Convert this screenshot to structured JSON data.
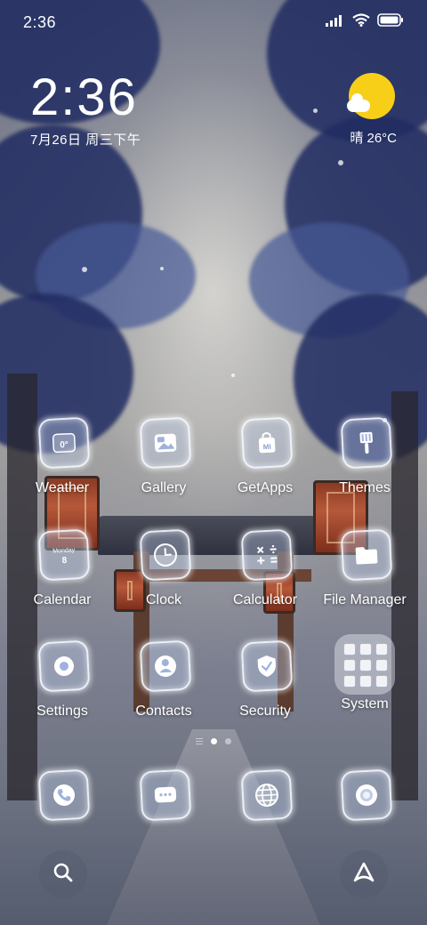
{
  "status_bar": {
    "time": "2:36",
    "icons": [
      "signal-icon",
      "wifi-icon",
      "battery-icon"
    ]
  },
  "clock_widget": {
    "time": "2:36",
    "date": "7月26日 周三下午"
  },
  "weather_widget": {
    "icon": "sun-cloud-icon",
    "text": "晴 26°C"
  },
  "apps": [
    {
      "label": "Weather",
      "icon": "weather-icon",
      "badge": "0°"
    },
    {
      "label": "Gallery",
      "icon": "gallery-icon"
    },
    {
      "label": "GetApps",
      "icon": "getapps-icon",
      "badge": "MI"
    },
    {
      "label": "Themes",
      "icon": "themes-icon"
    },
    {
      "label": "Calendar",
      "icon": "calendar-icon",
      "badge": "Monday",
      "badge2": "8"
    },
    {
      "label": "Clock",
      "icon": "clock-icon"
    },
    {
      "label": "Calculator",
      "icon": "calculator-icon"
    },
    {
      "label": "File Manager",
      "icon": "folder-icon"
    },
    {
      "label": "Settings",
      "icon": "settings-icon"
    },
    {
      "label": "Contacts",
      "icon": "contacts-icon"
    },
    {
      "label": "Security",
      "icon": "security-icon"
    },
    {
      "label": "System",
      "icon": "system-folder-icon"
    }
  ],
  "page_indicator": {
    "pages": 2,
    "active": 1
  },
  "dock": [
    "phone-icon",
    "messages-icon",
    "browser-icon",
    "camera-icon"
  ],
  "bottom_bar": {
    "left": "search-icon",
    "right": "assistant-icon"
  },
  "colors": {
    "sun": "#f7cf18",
    "label_text": "#ffffff"
  }
}
